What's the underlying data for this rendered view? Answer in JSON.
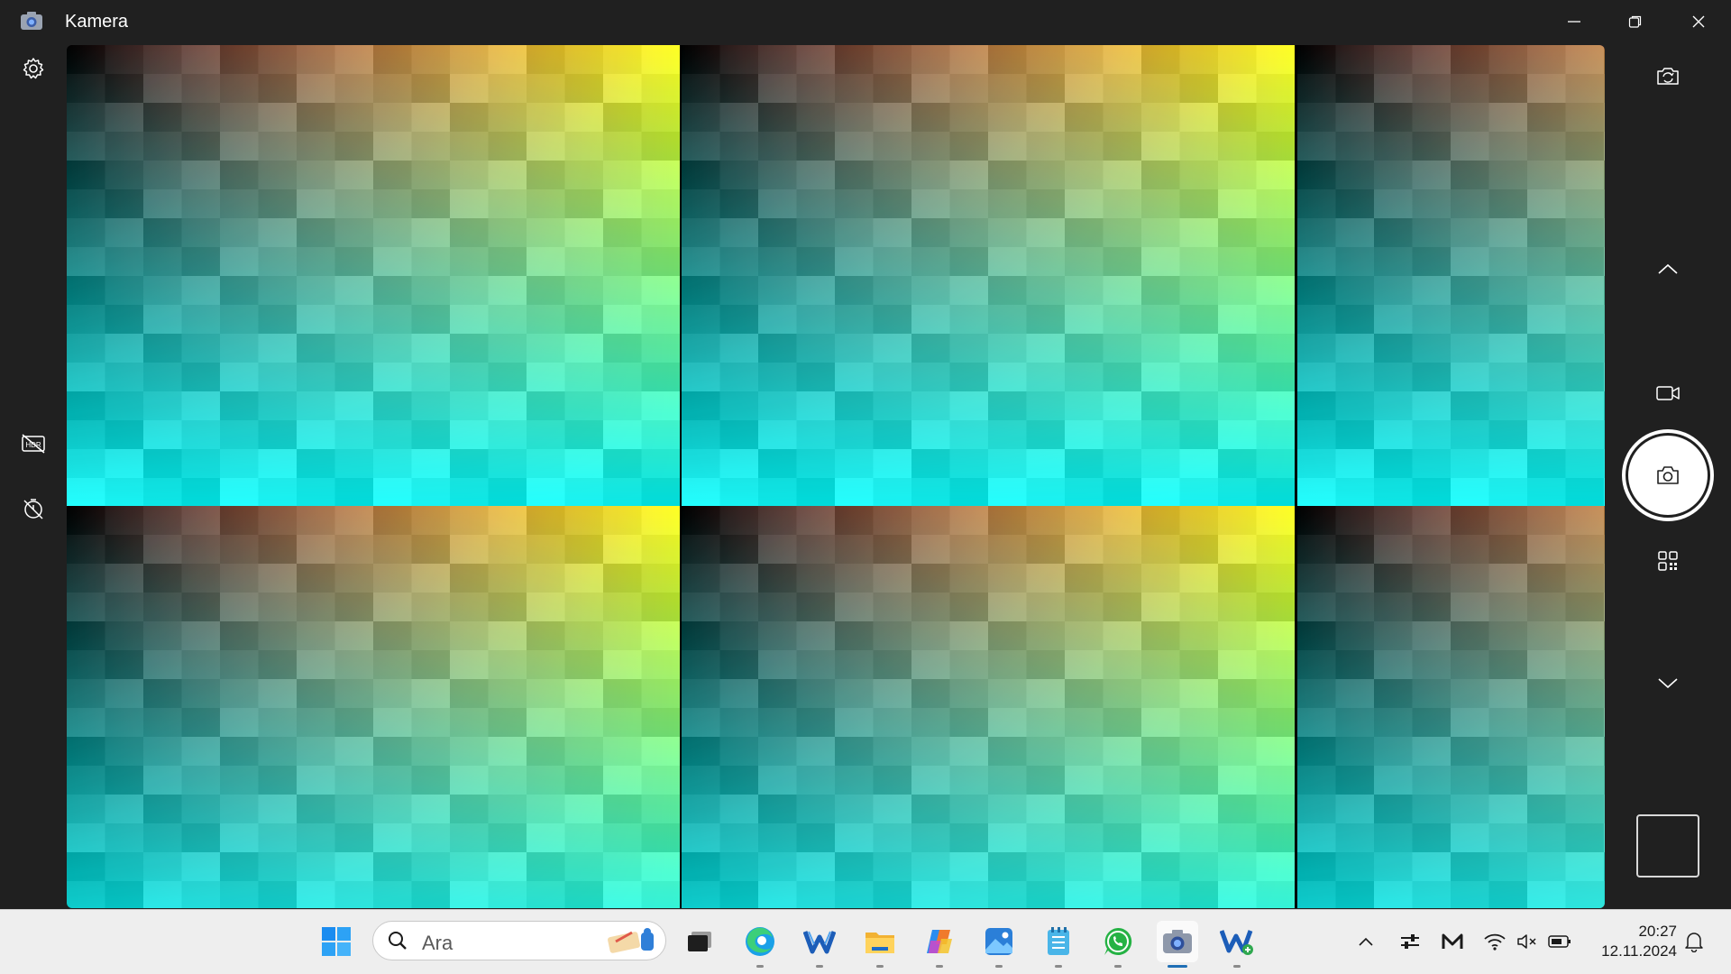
{
  "window": {
    "title": "Kamera",
    "icons": {
      "app": "camera-app-icon",
      "minimize": "minimize-icon",
      "maximize": "restore-icon",
      "close": "close-icon"
    }
  },
  "left_rail": {
    "icons": [
      "settings-icon",
      "hdr-off-icon",
      "timer-off-icon"
    ]
  },
  "right_rail": {
    "icons": [
      "switch-camera-icon",
      "chevron-up-icon",
      "video-mode-icon",
      "photo-shutter-icon",
      "qr-code-icon",
      "chevron-down-icon",
      "last-capture-thumbnail"
    ]
  },
  "preview": {
    "content": "color-gradient-test-pattern",
    "colors": {
      "black": "#000000",
      "magenta": "#ff00ff",
      "cyan": "#00ffff",
      "yellow": "#ffff00"
    }
  },
  "taskbar": {
    "search_placeholder": "Ara",
    "time": "20:27",
    "date": "12.11.2024",
    "pinned": [
      "start",
      "search",
      "task-view",
      "edge",
      "app-w",
      "file-explorer",
      "copilot",
      "photos",
      "notepad",
      "whatsapp",
      "camera",
      "app-w2"
    ],
    "active": "camera"
  },
  "colors": {
    "chrome": "#202020",
    "taskbar": "#eeeeee",
    "accent": "#1f6fb5"
  }
}
